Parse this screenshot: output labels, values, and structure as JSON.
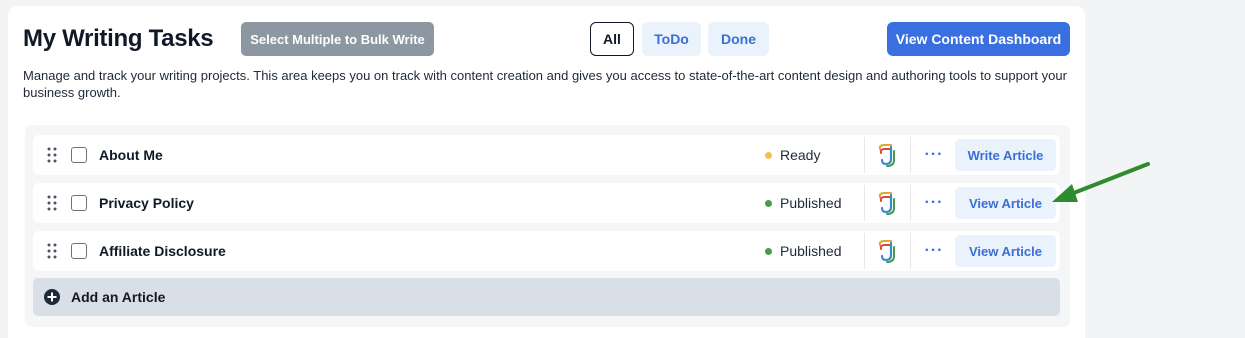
{
  "header": {
    "title": "My Writing Tasks",
    "bulk_button": "Select Multiple to Bulk Write",
    "filters": [
      {
        "label": "All",
        "active": true
      },
      {
        "label": "ToDo",
        "active": false
      },
      {
        "label": "Done",
        "active": false
      }
    ],
    "dashboard_button": "View Content Dashboard"
  },
  "description": "Manage and track your writing projects. This area keeps you on track with content creation and gives you access to state-of-the-art content design and authoring tools to support your business growth.",
  "articles": [
    {
      "title": "About Me",
      "status": "Ready",
      "status_color": "#f4c04f",
      "action": "Write Article",
      "more": "···"
    },
    {
      "title": "Privacy Policy",
      "status": "Published",
      "status_color": "#4a9a4f",
      "action": "View Article",
      "more": "···"
    },
    {
      "title": "Affiliate Disclosure",
      "status": "Published",
      "status_color": "#4a9a4f",
      "action": "View Article",
      "more": "···"
    }
  ],
  "add_article": "Add an Article",
  "colors": {
    "primary": "#3a6fdf",
    "link": "#3b6fd4",
    "annotation_arrow": "#2e8b2e"
  },
  "icons": {
    "drag": "drag-handle-icon",
    "ai_writer": "ai-writer-logo-icon",
    "add": "plus-circle-icon"
  }
}
